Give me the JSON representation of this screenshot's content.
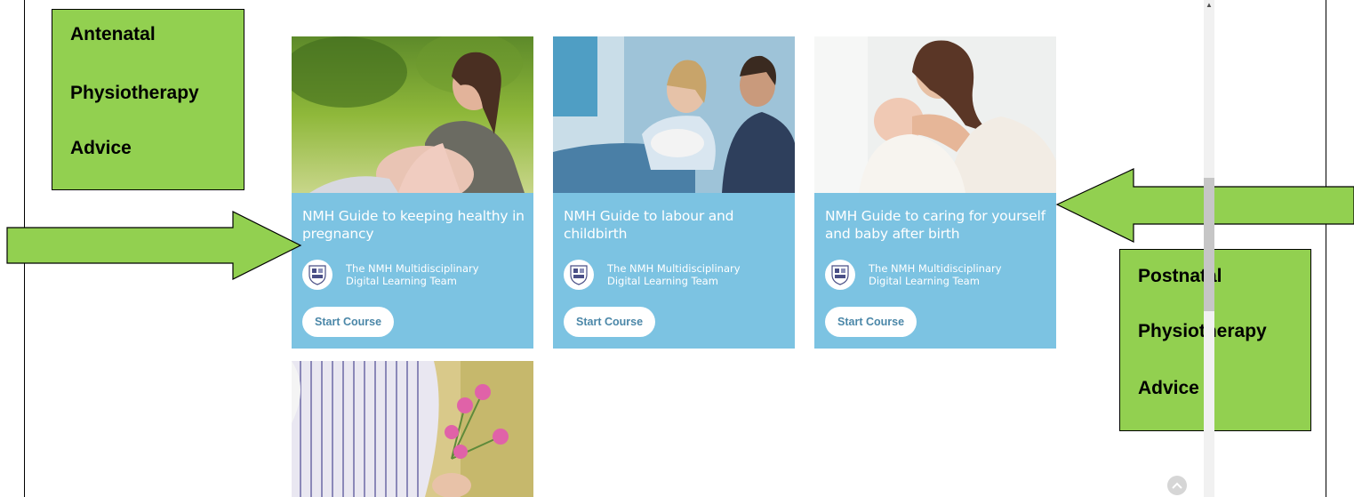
{
  "callouts": {
    "antenatal": {
      "lines": [
        "Antenatal",
        "Physiotherapy",
        "Advice"
      ]
    },
    "postnatal": {
      "lines": [
        "Postnatal",
        "Physiotherapy",
        "Advice"
      ]
    }
  },
  "courses": [
    {
      "title": "NMH Guide to keeping healthy in pregnancy",
      "author": "The NMH Multidisciplinary Digital Learning Team",
      "button": "Start Course"
    },
    {
      "title": "NMH Guide to labour and childbirth",
      "author": "The NMH Multidisciplinary Digital Learning Team",
      "button": "Start Course"
    },
    {
      "title": "NMH Guide to caring for yourself and baby after birth",
      "author": "The NMH Multidisciplinary Digital Learning Team",
      "button": "Start Course"
    }
  ],
  "colors": {
    "card": "#7cc3e2",
    "callout": "#92d050",
    "button_text": "#4b87a8"
  },
  "icons": {
    "author_logo": "crest-logo-icon",
    "back_to_top": "chevron-up-icon",
    "scroll_up": "scroll-up-arrow-icon"
  }
}
